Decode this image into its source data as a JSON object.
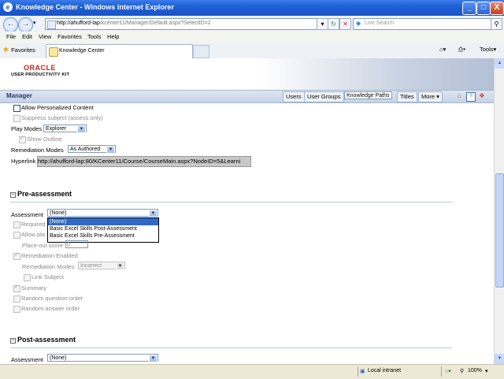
{
  "window": {
    "title": "Knowledge Center - Windows Internet Explorer",
    "minimize": "_",
    "maximize": "□",
    "close": "X"
  },
  "address": {
    "url_host": "http://ahufford-lap",
    "url_path": "/kcenter11/Manager/Default.aspx?SelectID=2",
    "search_placeholder": "Live Search"
  },
  "menu": [
    "File",
    "Edit",
    "View",
    "Favorites",
    "Tools",
    "Help"
  ],
  "favorites": {
    "label": "Favorites",
    "tab_title": "Knowledge Center",
    "tools": "Tools"
  },
  "brand": {
    "logo": "ORACLE",
    "product": "USER PRODUCTIVITY KIT"
  },
  "manager": {
    "title": "Manager",
    "tabs": [
      "Users",
      "User Groups",
      "Knowledge Paths",
      "Titles",
      "More ▾"
    ],
    "selected_tab": "Knowledge Paths"
  },
  "settings": {
    "allow_personalized": "Allow Personalized Content",
    "suppress_subject": "Suppress subject (assess only)",
    "play_modes_label": "Play Modes",
    "play_modes_value": "Explorer",
    "show_outline": "Show Outline",
    "remediation_modes_label": "Remediation Modes",
    "remediation_modes_value": "As Authored",
    "hyperlink_label": "Hyperlink",
    "hyperlink_value": "http://ahufford-lap:80/KCenter11/Course/CourseMain.aspx?NodeID=5&Learni"
  },
  "pre": {
    "header": "Pre-assessment",
    "assessment_label": "Assessment",
    "assessment_value": "(None)",
    "options": [
      "(None)",
      "Basic Excel Skills Post-Assessment",
      "Basic Excel Skills Pre-Assessment"
    ],
    "required": "Required",
    "allow_placeout": "Allow pla",
    "placeout_label": "Place-out score",
    "placeout_value": "0",
    "remediation_enabled": "Remediation Enabled",
    "remediation_modes_label": "Remediation Modes",
    "remediation_modes_value": "Incorrect",
    "link_subject": "Link Subject",
    "summary": "Summary",
    "random_question": "Random question order",
    "random_answer": "Random answer order"
  },
  "post": {
    "header": "Post-assessment",
    "assessment_label": "Assessment",
    "assessment_value": "(None)"
  },
  "status": {
    "zone": "Local intranet",
    "zoom": "100%"
  }
}
